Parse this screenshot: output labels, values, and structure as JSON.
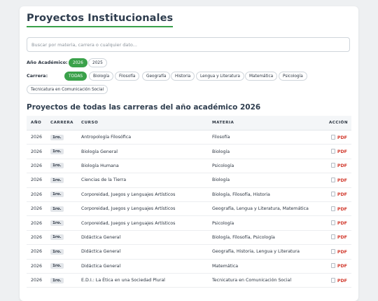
{
  "page": {
    "title": "Proyectos Institucionales",
    "search_placeholder": "Buscar por materia, carrera o cualquier dato...",
    "year_label": "Año Académico:",
    "career_label": "Carrera:",
    "subtitle": "Proyectos de todas las carreras del año académico 2026"
  },
  "years": [
    {
      "label": "2026",
      "active": true
    },
    {
      "label": "2025",
      "active": false
    }
  ],
  "careers": [
    {
      "label": "TODAS",
      "active": true
    },
    {
      "label": "Biología",
      "active": false
    },
    {
      "label": "Filosofía",
      "active": false
    },
    {
      "label": "Geografía",
      "active": false
    },
    {
      "label": "Historia",
      "active": false
    },
    {
      "label": "Lengua y Literatura",
      "active": false
    },
    {
      "label": "Matemática",
      "active": false
    },
    {
      "label": "Psicología",
      "active": false
    },
    {
      "label": "Tecnicatura en Comunicación Social",
      "active": false
    }
  ],
  "table": {
    "headers": [
      "AÑO",
      "CARRERA",
      "CURSO",
      "MATERIA",
      "ACCIÓN"
    ],
    "action_label": "PDF",
    "rows": [
      {
        "year": "2026",
        "course": "1ro.",
        "subject": "Antropología Filosófica",
        "career": "Filosofía"
      },
      {
        "year": "2026",
        "course": "1ro.",
        "subject": "Biología General",
        "career": "Biología"
      },
      {
        "year": "2026",
        "course": "1ro.",
        "subject": "Biología Humana",
        "career": "Psicología"
      },
      {
        "year": "2026",
        "course": "1ro.",
        "subject": "Ciencias de la Tierra",
        "career": "Biología"
      },
      {
        "year": "2026",
        "course": "1ro.",
        "subject": "Corporeidad, Juegos y Lenguajes Artísticos",
        "career": "Biología, Filosofía, Historia"
      },
      {
        "year": "2026",
        "course": "1ro.",
        "subject": "Corporeidad, Juegos y Lenguajes Artísticos",
        "career": "Geografía, Lengua y Literatura, Matemática"
      },
      {
        "year": "2026",
        "course": "1ro.",
        "subject": "Corporeidad, Juegos y Lenguajes Artísticos",
        "career": "Psicología"
      },
      {
        "year": "2026",
        "course": "1ro.",
        "subject": "Didáctica General",
        "career": "Biología, Filosofía, Psicología"
      },
      {
        "year": "2026",
        "course": "1ro.",
        "subject": "Didáctica General",
        "career": "Geografía, Historia, Lengua y Literatura"
      },
      {
        "year": "2026",
        "course": "1ro.",
        "subject": "Didáctica General",
        "career": "Matemática"
      },
      {
        "year": "2026",
        "course": "1ro.",
        "subject": "E.D.I.: La Ética en una Sociedad Plural",
        "career": "Tecnicatura en Comunicación Social"
      }
    ]
  },
  "colors": {
    "accent": "#3aa14a",
    "pdf": "#d23b2f"
  }
}
